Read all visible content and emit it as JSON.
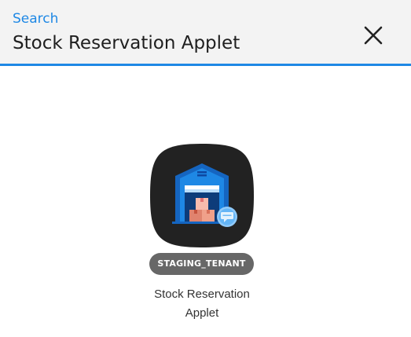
{
  "header": {
    "breadcrumb": "Search",
    "title": "Stock Reservation Applet",
    "close_icon": "close-icon"
  },
  "colors": {
    "accent": "#1e88e5",
    "header_bg": "#f3f3f3",
    "icon_bg": "#222222",
    "badge_bg": "#676767"
  },
  "results": [
    {
      "icon": "warehouse-icon",
      "tenant_badge": "STAGING_TENANT",
      "name_line1": "Stock Reservation",
      "name_line2": "Applet"
    }
  ]
}
